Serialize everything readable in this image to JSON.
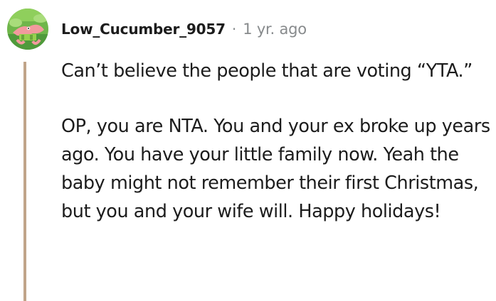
{
  "comment": {
    "author": "Low_Cucumber_9057",
    "separator": "·",
    "age": "1 yr. ago",
    "avatar_icon": "patrick-star-avatar-icon",
    "thread_line_color": "#c0a489",
    "paragraphs": [
      "Can’t believe the people that are voting “YTA.”",
      "OP, you are NTA. You and your ex broke up years ago. You have your little family now. Yeah the baby might not remember their first Christmas, but you and your wife will. Happy holidays!"
    ]
  }
}
